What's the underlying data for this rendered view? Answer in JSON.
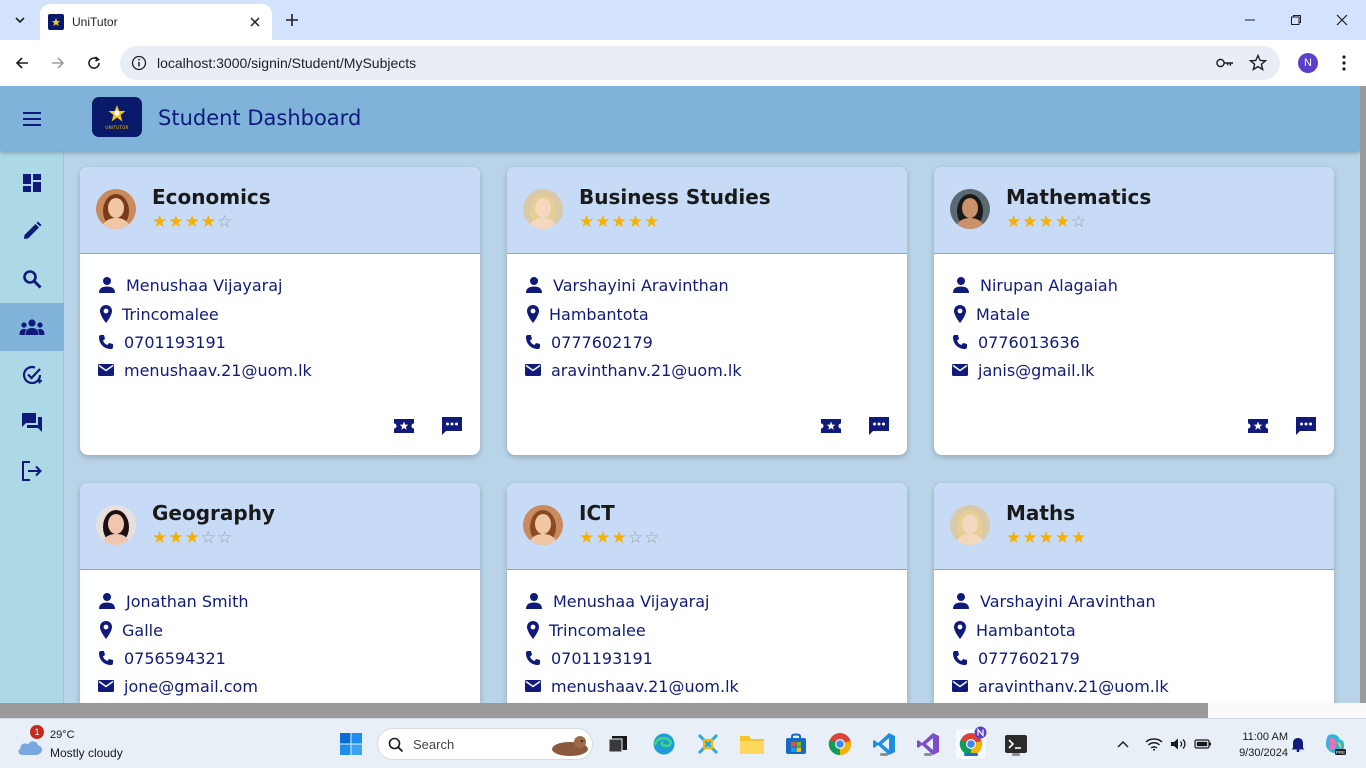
{
  "browser": {
    "tab_title": "UniTutor",
    "url": "localhost:3000/signin/Student/MySubjects",
    "profile_initial": "N"
  },
  "app": {
    "title": "Student Dashboard",
    "logo_text": "UNITUTOR",
    "sidebar_items": [
      {
        "name": "dashboard",
        "icon": "dashboard-icon"
      },
      {
        "name": "edit",
        "icon": "pencil-icon"
      },
      {
        "name": "search",
        "icon": "search-icon"
      },
      {
        "name": "my-subjects",
        "icon": "group-icon",
        "active": true
      },
      {
        "name": "tasks",
        "icon": "check-circle-icon"
      },
      {
        "name": "messages",
        "icon": "chat-icon"
      },
      {
        "name": "logout",
        "icon": "logout-icon"
      }
    ],
    "cards": [
      {
        "subject": "Economics",
        "rating": 4,
        "name": "Menushaa Vijayaraj",
        "location": "Trincomalee",
        "phone": "0701193191",
        "email": "menushaav.21@uom.lk"
      },
      {
        "subject": "Business Studies",
        "rating": 5,
        "name": "Varshayini Aravinthan",
        "location": "Hambantota",
        "phone": "0777602179",
        "email": "aravinthanv.21@uom.lk"
      },
      {
        "subject": "Mathematics",
        "rating": 4,
        "name": "Nirupan Alagaiah",
        "location": "Matale",
        "phone": "0776013636",
        "email": "janis@gmail.lk"
      },
      {
        "subject": "Geography",
        "rating": 3,
        "name": "Jonathan Smith",
        "location": "Galle",
        "phone": "0756594321",
        "email": "jone@gmail.com"
      },
      {
        "subject": "ICT",
        "rating": 3,
        "name": "Menushaa Vijayaraj",
        "location": "Trincomalee",
        "phone": "0701193191",
        "email": "menushaav.21@uom.lk"
      },
      {
        "subject": "Maths",
        "rating": 5,
        "name": "Varshayini Aravinthan",
        "location": "Hambantota",
        "phone": "0777602179",
        "email": "aravinthanv.21@uom.lk"
      }
    ]
  },
  "taskbar": {
    "weather_temp": "29°C",
    "weather_desc": "Mostly cloudy",
    "weather_badge": "1",
    "search_placeholder": "Search",
    "time": "11:00 AM",
    "date": "9/30/2024"
  },
  "colors": {
    "accent": "#101a7a",
    "star": "#f6b000",
    "card_header": "#c7dbf7",
    "appbar": "#7fb3d9"
  }
}
